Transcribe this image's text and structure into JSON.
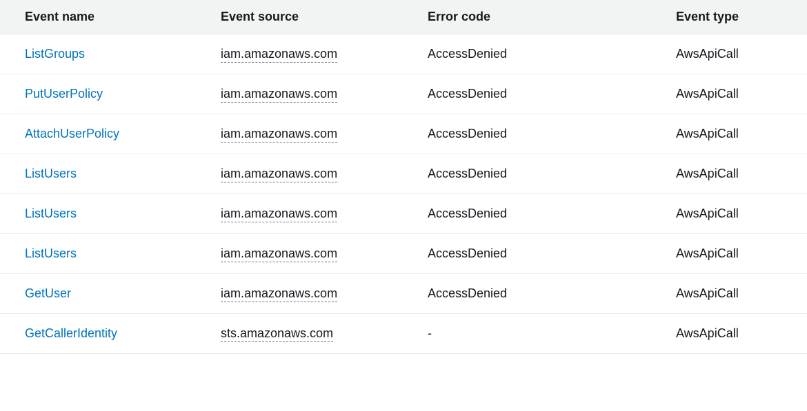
{
  "table": {
    "headers": {
      "event_name": "Event name",
      "event_source": "Event source",
      "error_code": "Error code",
      "event_type": "Event type"
    },
    "rows": [
      {
        "event_name": "ListGroups",
        "event_source": "iam.amazonaws.com",
        "error_code": "AccessDenied",
        "event_type": "AwsApiCall"
      },
      {
        "event_name": "PutUserPolicy",
        "event_source": "iam.amazonaws.com",
        "error_code": "AccessDenied",
        "event_type": "AwsApiCall"
      },
      {
        "event_name": "AttachUserPolicy",
        "event_source": "iam.amazonaws.com",
        "error_code": "AccessDenied",
        "event_type": "AwsApiCall"
      },
      {
        "event_name": "ListUsers",
        "event_source": "iam.amazonaws.com",
        "error_code": "AccessDenied",
        "event_type": "AwsApiCall"
      },
      {
        "event_name": "ListUsers",
        "event_source": "iam.amazonaws.com",
        "error_code": "AccessDenied",
        "event_type": "AwsApiCall"
      },
      {
        "event_name": "ListUsers",
        "event_source": "iam.amazonaws.com",
        "error_code": "AccessDenied",
        "event_type": "AwsApiCall"
      },
      {
        "event_name": "GetUser",
        "event_source": "iam.amazonaws.com",
        "error_code": "AccessDenied",
        "event_type": "AwsApiCall"
      },
      {
        "event_name": "GetCallerIdentity",
        "event_source": "sts.amazonaws.com",
        "error_code": "-",
        "event_type": "AwsApiCall"
      }
    ]
  }
}
